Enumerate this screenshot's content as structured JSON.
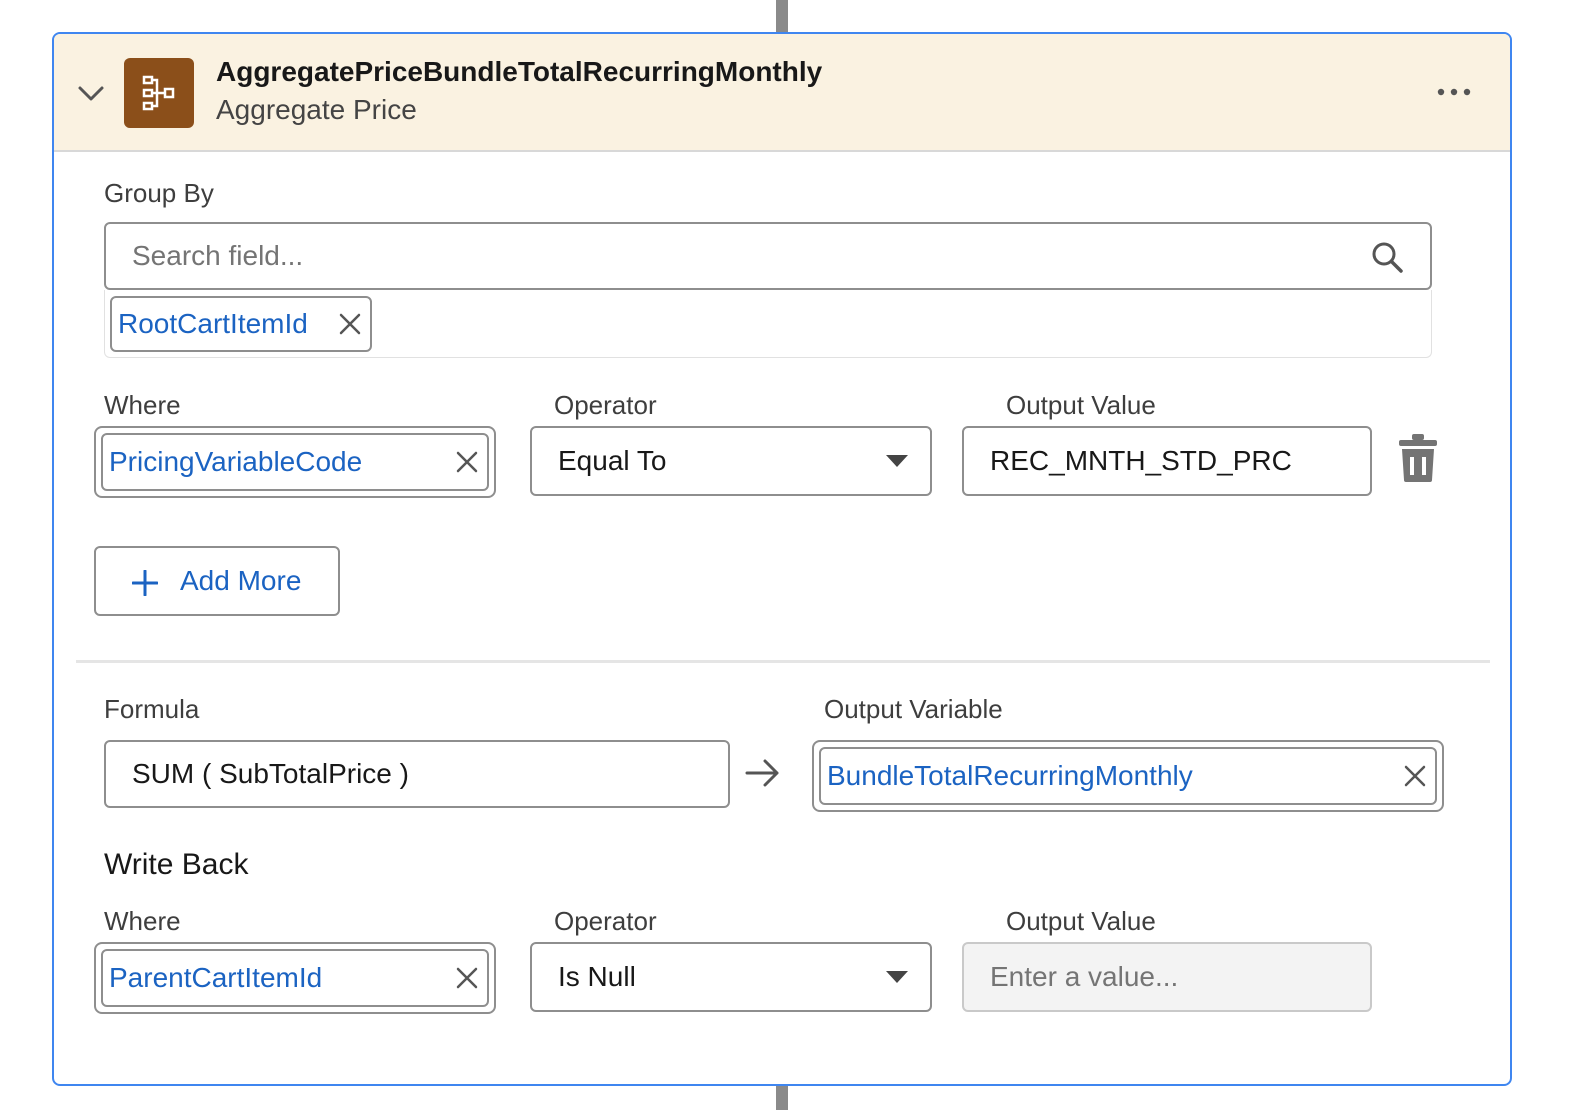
{
  "node": {
    "title": "AggregatePriceBundleTotalRecurringMonthly",
    "subtitle": "Aggregate Price",
    "icon": "aggregate-hierarchy-icon",
    "accent_color": "#3f86f0",
    "icon_bg": "#8b4f1a",
    "header_bg": "#faf2e1"
  },
  "group_by": {
    "label": "Group By",
    "search_placeholder": "Search field...",
    "selected": [
      "RootCartItemId"
    ]
  },
  "condition": {
    "where_label": "Where",
    "operator_label": "Operator",
    "output_label": "Output Value",
    "where_value": "PricingVariableCode",
    "operator_value": "Equal To",
    "output_value": "REC_MNTH_STD_PRC"
  },
  "add_more_label": "Add More",
  "formula": {
    "label": "Formula",
    "value": "SUM ( SubTotalPrice )",
    "output_variable_label": "Output Variable",
    "output_variable_value": "BundleTotalRecurringMonthly"
  },
  "write_back": {
    "heading": "Write Back",
    "where_label": "Where",
    "operator_label": "Operator",
    "output_label": "Output Value",
    "where_value": "ParentCartItemId",
    "operator_value": "Is Null",
    "output_placeholder": "Enter a value..."
  }
}
